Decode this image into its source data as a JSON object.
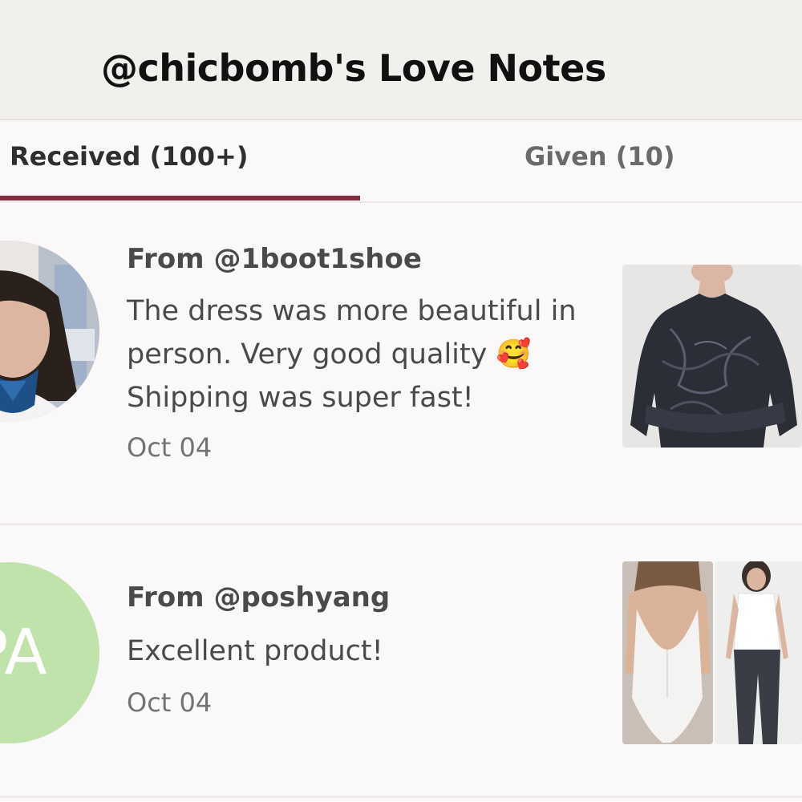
{
  "header": {
    "title": "@chicbomb's Love Notes"
  },
  "tabs": [
    {
      "label": "Received (100+)",
      "active": true
    },
    {
      "label": "Given (10)",
      "active": false
    }
  ],
  "notes": [
    {
      "from": "From @1boot1shoe",
      "message": "The dress was more beautiful in person. Very good quality 🥰 Shipping was super fast!",
      "date": "Oct 04",
      "avatar_type": "photo"
    },
    {
      "from": "From @poshyang",
      "message": "Excellent product!",
      "date": "Oct 04",
      "avatar_type": "initials",
      "avatar_initials": "PA",
      "avatar_color": "#bfe3ab"
    }
  ],
  "colors": {
    "accent": "#822c3d",
    "header_bg": "#f2f0ed",
    "page_bg": "#faf8f9"
  }
}
